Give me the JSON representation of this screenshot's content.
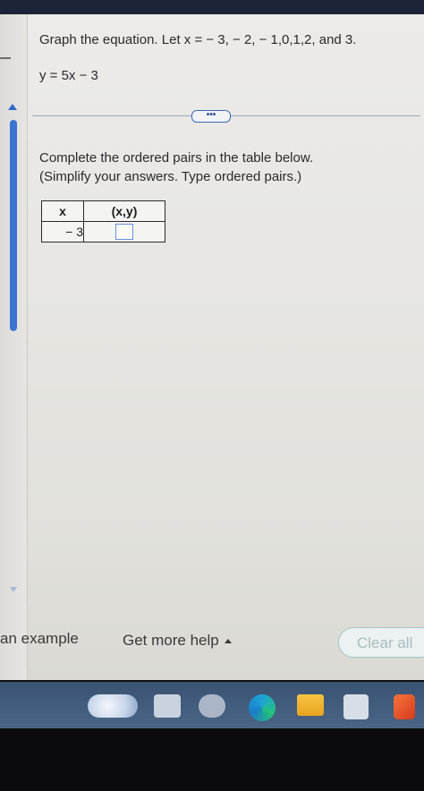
{
  "question": {
    "prompt": "Graph the equation. Let x = − 3, − 2, − 1,0,1,2, and 3.",
    "equation": "y = 5x − 3"
  },
  "expand_button": {
    "label": "•••"
  },
  "instructions": {
    "line1": "Complete the ordered pairs in the table below.",
    "line2": "(Simplify your answers. Type ordered pairs.)"
  },
  "table": {
    "headers": [
      "x",
      "(x,y)"
    ],
    "rows": [
      {
        "x": "− 3",
        "xy": ""
      }
    ]
  },
  "footer": {
    "example_link": "an example",
    "help_link": "Get more help",
    "clear_button": "Clear all"
  },
  "taskbar": {
    "icons": [
      "weather-icon",
      "search-icon",
      "chat-icon",
      "edge-browser-icon",
      "file-explorer-icon",
      "store-icon",
      "office-icon"
    ]
  },
  "colors": {
    "accent": "#3c74d1",
    "taskbar": "#3a5373",
    "clear_border": "#9fc7c9"
  }
}
